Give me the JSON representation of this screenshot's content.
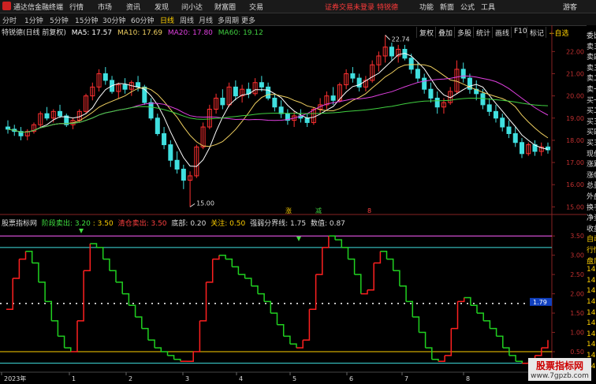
{
  "app": {
    "title": "通达信金融终端"
  },
  "menu": [
    "行情",
    "市场",
    "资讯",
    "发现",
    "问小达",
    "财富圈",
    "交易"
  ],
  "login_status": "证券交易未登录",
  "stock_name_top": "特锐德",
  "top_right": [
    "功能",
    "新面",
    "公式",
    "工具",
    "游客"
  ],
  "periods": [
    "分时",
    "1分钟",
    "5分钟",
    "15分钟",
    "30分钟",
    "60分钟",
    "日线",
    "周线",
    "月线",
    "多周期",
    "更多"
  ],
  "active_period": "日线",
  "right_tools": [
    "复权",
    "叠加",
    "多股",
    "统计",
    "画线",
    "F10",
    "标记",
    "+自选"
  ],
  "legend": {
    "name": "特锐德(日线 前复权)",
    "ma5": "MA5: 17.57",
    "ma10": "MA10: 17.69",
    "ma20": "MA20: 17.80",
    "ma60": "MA60: 19.12"
  },
  "colors": {
    "up": "#ff3030",
    "down": "#40e0e0",
    "ma5": "#ffffff",
    "ma10": "#f0d060",
    "ma20": "#e040e0",
    "ma60": "#40d040",
    "ind_red": "#ff2020",
    "ind_green": "#20d020"
  },
  "price_axis": [
    "22.00",
    "21.00",
    "20.00",
    "19.00",
    "18.00",
    "17.00",
    "16.00",
    "15.00"
  ],
  "annotations": {
    "high": "22.74",
    "low": "15.00",
    "current": "1.79"
  },
  "markers": [
    "涨",
    "减",
    "8"
  ],
  "indicator": {
    "name": "股票指标网",
    "items": [
      {
        "label": "阶段卖出:",
        "value": "3.20"
      },
      {
        "label": "",
        "value": "3.50"
      },
      {
        "label": "清仓卖出:",
        "value": "3.50"
      },
      {
        "label": "底部:",
        "value": "0.20"
      },
      {
        "label": "关注:",
        "value": "0.50"
      },
      {
        "label": "强弱分界线:",
        "value": "1.75"
      },
      {
        "label": "数值:",
        "value": "0.87"
      }
    ],
    "axis": [
      "3.50",
      "3.00",
      "2.50",
      "2.00",
      "1.50",
      "1.00",
      "0.50"
    ]
  },
  "x_labels": [
    "2023年",
    "1",
    "2",
    "3",
    "4",
    "5",
    "6",
    "7",
    "8"
  ],
  "side_labels": [
    "委比",
    "卖五",
    "卖四",
    "卖三",
    "卖二",
    "卖一",
    "买一",
    "买二",
    "买三",
    "买四",
    "买五",
    "现价",
    "涨跌",
    "涨幅",
    "总量",
    "外盘",
    "换手",
    "净资",
    "收益",
    "自动",
    "行情",
    "盘后",
    "14:5",
    "14:5",
    "14:5",
    "14:5",
    "14:5",
    "14:5",
    "14:5",
    "14:5",
    "14:5",
    "14:5"
  ],
  "watermark": {
    "title": "股票指标网",
    "url": "www.7gpzb.com"
  },
  "ohlc": [
    [
      18.6,
      18.9,
      18.3,
      18.5
    ],
    [
      18.5,
      18.7,
      18.2,
      18.4
    ],
    [
      18.4,
      18.6,
      18.0,
      18.2
    ],
    [
      18.2,
      18.5,
      18.0,
      18.4
    ],
    [
      18.4,
      18.8,
      18.3,
      18.7
    ],
    [
      18.7,
      19.3,
      18.6,
      19.2
    ],
    [
      19.2,
      19.5,
      18.9,
      19.0
    ],
    [
      19.0,
      19.4,
      18.8,
      19.3
    ],
    [
      19.3,
      19.6,
      19.0,
      19.1
    ],
    [
      19.1,
      19.2,
      18.6,
      18.7
    ],
    [
      18.7,
      19.0,
      18.5,
      18.9
    ],
    [
      18.9,
      19.4,
      18.8,
      19.3
    ],
    [
      19.3,
      20.1,
      19.2,
      20.0
    ],
    [
      20.0,
      20.6,
      19.8,
      20.4
    ],
    [
      20.4,
      21.2,
      20.2,
      21.0
    ],
    [
      21.0,
      21.3,
      20.5,
      20.7
    ],
    [
      20.7,
      20.9,
      20.1,
      20.2
    ],
    [
      20.2,
      20.6,
      19.9,
      20.5
    ],
    [
      20.5,
      20.8,
      20.1,
      20.3
    ],
    [
      20.3,
      20.7,
      20.0,
      20.6
    ],
    [
      20.6,
      20.9,
      20.2,
      20.4
    ],
    [
      20.4,
      20.5,
      19.6,
      19.7
    ],
    [
      19.7,
      19.9,
      18.9,
      19.0
    ],
    [
      19.0,
      19.2,
      18.2,
      18.3
    ],
    [
      18.3,
      18.6,
      17.6,
      17.8
    ],
    [
      17.8,
      18.0,
      16.8,
      17.1
    ],
    [
      17.1,
      17.5,
      16.5,
      16.7
    ],
    [
      16.7,
      16.9,
      15.8,
      16.2
    ],
    [
      16.2,
      16.6,
      15.0,
      16.4
    ],
    [
      16.4,
      17.8,
      16.3,
      17.7
    ],
    [
      17.7,
      18.8,
      17.6,
      18.6
    ],
    [
      18.6,
      19.6,
      18.5,
      19.4
    ],
    [
      19.4,
      20.1,
      19.2,
      19.9
    ],
    [
      19.9,
      20.3,
      19.4,
      19.6
    ],
    [
      19.6,
      20.6,
      19.5,
      20.4
    ],
    [
      20.4,
      20.7,
      19.8,
      20.0
    ],
    [
      20.0,
      20.5,
      19.7,
      20.3
    ],
    [
      20.3,
      20.6,
      19.9,
      20.1
    ],
    [
      20.1,
      20.8,
      20.0,
      20.6
    ],
    [
      20.6,
      20.9,
      20.2,
      20.4
    ],
    [
      20.4,
      20.6,
      19.8,
      19.9
    ],
    [
      19.9,
      20.1,
      19.3,
      19.5
    ],
    [
      19.5,
      19.8,
      19.0,
      19.2
    ],
    [
      19.2,
      19.4,
      18.7,
      18.9
    ],
    [
      18.9,
      19.3,
      18.6,
      19.1
    ],
    [
      19.1,
      19.4,
      18.8,
      19.0
    ],
    [
      19.0,
      19.2,
      18.6,
      18.8
    ],
    [
      18.8,
      19.5,
      18.7,
      19.4
    ],
    [
      19.4,
      19.9,
      19.2,
      19.6
    ],
    [
      19.6,
      20.2,
      19.4,
      20.0
    ],
    [
      20.0,
      20.4,
      19.6,
      19.8
    ],
    [
      19.8,
      20.6,
      19.7,
      20.5
    ],
    [
      20.5,
      21.2,
      20.3,
      21.0
    ],
    [
      21.0,
      21.3,
      20.6,
      20.8
    ],
    [
      20.8,
      21.0,
      20.2,
      20.4
    ],
    [
      20.4,
      20.9,
      20.2,
      20.7
    ],
    [
      20.7,
      21.6,
      20.6,
      21.4
    ],
    [
      21.4,
      22.0,
      21.1,
      21.8
    ],
    [
      21.8,
      22.74,
      21.5,
      22.2
    ],
    [
      22.2,
      22.4,
      21.6,
      21.8
    ],
    [
      21.8,
      22.3,
      21.5,
      22.1
    ],
    [
      22.1,
      22.3,
      21.6,
      21.7
    ],
    [
      21.7,
      21.9,
      21.0,
      21.2
    ],
    [
      21.2,
      21.5,
      20.6,
      20.8
    ],
    [
      20.8,
      21.0,
      20.1,
      20.3
    ],
    [
      20.3,
      20.6,
      19.7,
      19.9
    ],
    [
      19.9,
      20.2,
      19.2,
      19.5
    ],
    [
      19.5,
      19.9,
      19.2,
      19.7
    ],
    [
      19.7,
      20.4,
      19.6,
      20.2
    ],
    [
      20.2,
      21.6,
      20.1,
      21.2
    ],
    [
      21.2,
      21.5,
      20.6,
      20.8
    ],
    [
      20.8,
      21.0,
      20.1,
      20.3
    ],
    [
      20.3,
      20.7,
      19.8,
      20.1
    ],
    [
      20.1,
      20.3,
      19.4,
      19.6
    ],
    [
      19.6,
      19.9,
      19.1,
      19.3
    ],
    [
      19.3,
      19.6,
      18.8,
      19.0
    ],
    [
      19.0,
      19.2,
      18.4,
      18.6
    ],
    [
      18.6,
      18.9,
      18.1,
      18.3
    ],
    [
      18.3,
      18.6,
      17.7,
      17.9
    ],
    [
      17.9,
      18.1,
      17.2,
      17.4
    ],
    [
      17.4,
      17.9,
      17.3,
      17.8
    ],
    [
      17.8,
      18.0,
      17.3,
      17.5
    ],
    [
      17.5,
      17.9,
      17.3,
      17.7
    ],
    [
      17.7,
      17.9,
      17.4,
      17.57
    ]
  ],
  "indicator_series": [
    1.6,
    2.4,
    2.9,
    3.1,
    2.8,
    2.3,
    1.8,
    1.3,
    0.9,
    0.6,
    0.5,
    1.3,
    2.6,
    3.3,
    3.2,
    2.9,
    2.6,
    2.3,
    2.0,
    1.7,
    1.4,
    1.1,
    0.8,
    0.6,
    0.5,
    0.4,
    0.3,
    0.25,
    0.25,
    0.5,
    1.3,
    2.3,
    2.9,
    3.0,
    2.9,
    2.7,
    2.5,
    2.4,
    2.2,
    2.0,
    1.8,
    1.5,
    1.2,
    0.9,
    0.7,
    0.6,
    0.8,
    1.6,
    2.5,
    3.2,
    3.5,
    3.4,
    3.2,
    2.9,
    2.5,
    2.0,
    2.1,
    2.8,
    3.1,
    2.9,
    2.6,
    2.2,
    1.8,
    1.4,
    1.0,
    0.6,
    0.3,
    0.25,
    0.4,
    1.1,
    1.8,
    1.9,
    1.7,
    1.5,
    1.3,
    1.1,
    0.9,
    0.6,
    0.4,
    0.25,
    0.2,
    0.25,
    0.4,
    0.6,
    0.8
  ]
}
